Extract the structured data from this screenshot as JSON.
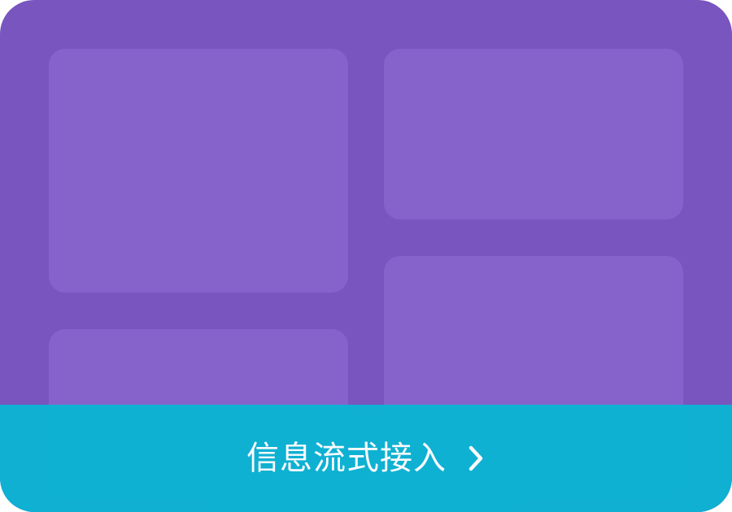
{
  "colors": {
    "background": "#7955bf",
    "tile": "#8663cb",
    "footer": "#0bb4d3",
    "text": "#ffffff"
  },
  "footer": {
    "label": "信息流式接入",
    "icon": "chevron-right-icon"
  }
}
